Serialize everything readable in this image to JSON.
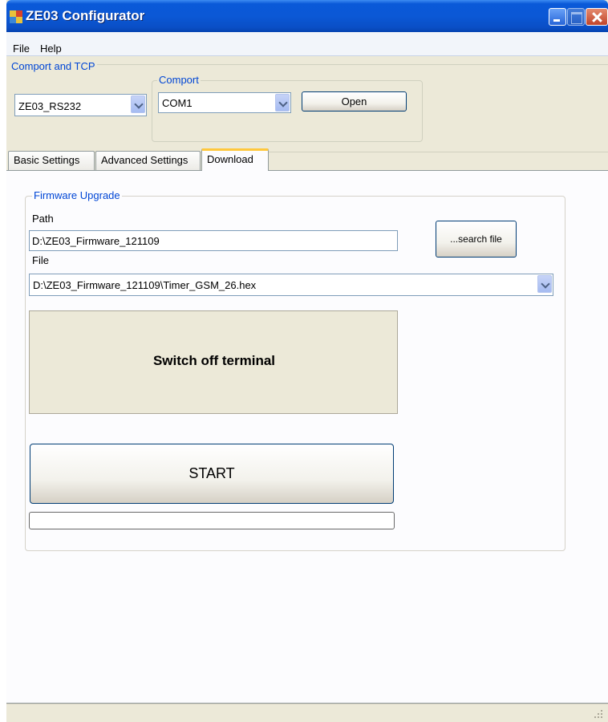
{
  "window": {
    "title": "ZE03 Configurator",
    "title_bar_color": "#0a59d8",
    "controls": [
      "minimize-icon",
      "maximize-icon",
      "close-icon"
    ]
  },
  "menu": {
    "items": [
      "File",
      "Help"
    ]
  },
  "connection": {
    "group_label": "Comport and TCP",
    "type_value": "ZE03_RS232",
    "comport_group_label": "Comport",
    "comport_value": "COM1",
    "open_label": "Open"
  },
  "tabs": [
    {
      "label": "Basic Settings",
      "active": false
    },
    {
      "label": "Advanced Settings",
      "active": false
    },
    {
      "label": "Download",
      "active": true
    }
  ],
  "firmware": {
    "group_label": "Firmware Upgrade",
    "path_label": "Path",
    "path_value": "D:\\ZE03_Firmware_121109",
    "search_label": "...search file",
    "file_label": "File",
    "file_value": "D:\\ZE03_Firmware_121109\\Timer_GSM_26.hex",
    "status_text": "Switch off terminal",
    "start_label": "START",
    "progress": 0
  }
}
